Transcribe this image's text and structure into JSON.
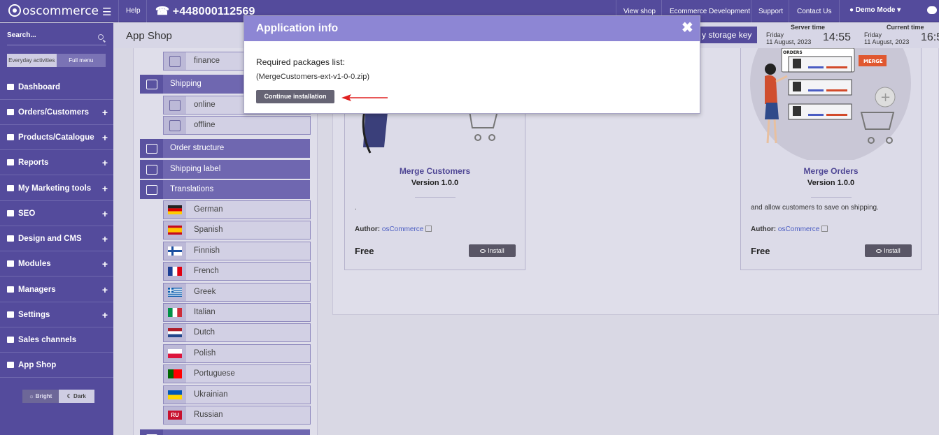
{
  "topbar": {
    "brand": "oscommerce",
    "help": "Help",
    "phone": "+448000112569",
    "nav": [
      "View shop",
      "Ecommerce Development",
      "Support",
      "Contact Us"
    ],
    "demo_mode": "Demo Mode"
  },
  "sidebar": {
    "search_placeholder": "Search...",
    "menu_switch": [
      "Everyday activities",
      "Full menu"
    ],
    "items": [
      {
        "label": "Dashboard",
        "icon": "dashboard-icon",
        "plus": ""
      },
      {
        "label": "Orders/Customers",
        "icon": "users-icon",
        "plus": "+"
      },
      {
        "label": "Products/Catalogue",
        "icon": "folder-icon",
        "plus": "+"
      },
      {
        "label": "Reports",
        "icon": "chart-icon",
        "plus": "+"
      },
      {
        "label": "My Marketing tools",
        "icon": "tag-icon",
        "plus": "+"
      },
      {
        "label": "SEO",
        "icon": "sitemap-icon",
        "plus": "+"
      },
      {
        "label": "Design and CMS",
        "icon": "brush-icon",
        "plus": "+"
      },
      {
        "label": "Modules",
        "icon": "puzzle-icon",
        "plus": "+"
      },
      {
        "label": "Managers",
        "icon": "user-icon",
        "plus": "+"
      },
      {
        "label": "Settings",
        "icon": "gears-icon",
        "plus": "+"
      },
      {
        "label": "Sales channels",
        "icon": "monitor-icon",
        "plus": ""
      },
      {
        "label": "App Shop",
        "icon": "cart-icon",
        "plus": ""
      }
    ],
    "theme": [
      "Bright",
      "Dark"
    ]
  },
  "header": {
    "title": "App Shop",
    "storage_key": "y storage key",
    "server_time_label": "Server time",
    "server_day": "Friday",
    "server_date": "11 August, 2023",
    "server_time": "14:55",
    "current_time_label": "Current time",
    "current_day": "Friday",
    "current_date": "11 August, 2023",
    "current_time": "16:5"
  },
  "tree": {
    "finance": "finance",
    "shipping": "Shipping",
    "online": "online",
    "offline": "offline",
    "order_structure": "Order structure",
    "shipping_label": "Shipping label",
    "translations": "Translations",
    "languages": [
      "German",
      "Spanish",
      "Finnish",
      "French",
      "Greek",
      "Italian",
      "Dutch",
      "Polish",
      "Portuguese",
      "Ukrainian",
      "Russian"
    ],
    "ru_flag": "RU"
  },
  "cards": [
    {
      "name": "Merge Customers",
      "version": "Version 1.0.0",
      "desc": ".",
      "author_label": "Author:",
      "author": "osCommerce",
      "price": "Free",
      "install": "Install"
    },
    {
      "name": "Merge Orders",
      "version": "Version 1.0.0",
      "desc": "and allow customers to save on shipping.",
      "author_label": "Author:",
      "author": "osCommerce",
      "price": "Free",
      "install": "Install",
      "art_orders": "ORDERS",
      "art_merge": "MERGE"
    }
  ],
  "modal": {
    "title": "Application info",
    "close": "✖",
    "required": "Required packages list:",
    "package": "(MergeCustomers-ext-v1-0-0.zip)",
    "continue": "Continue installation"
  },
  "colors": {
    "brand": "#544b9c",
    "modal_header": "#8d86d4",
    "arrow": "#e02020"
  }
}
